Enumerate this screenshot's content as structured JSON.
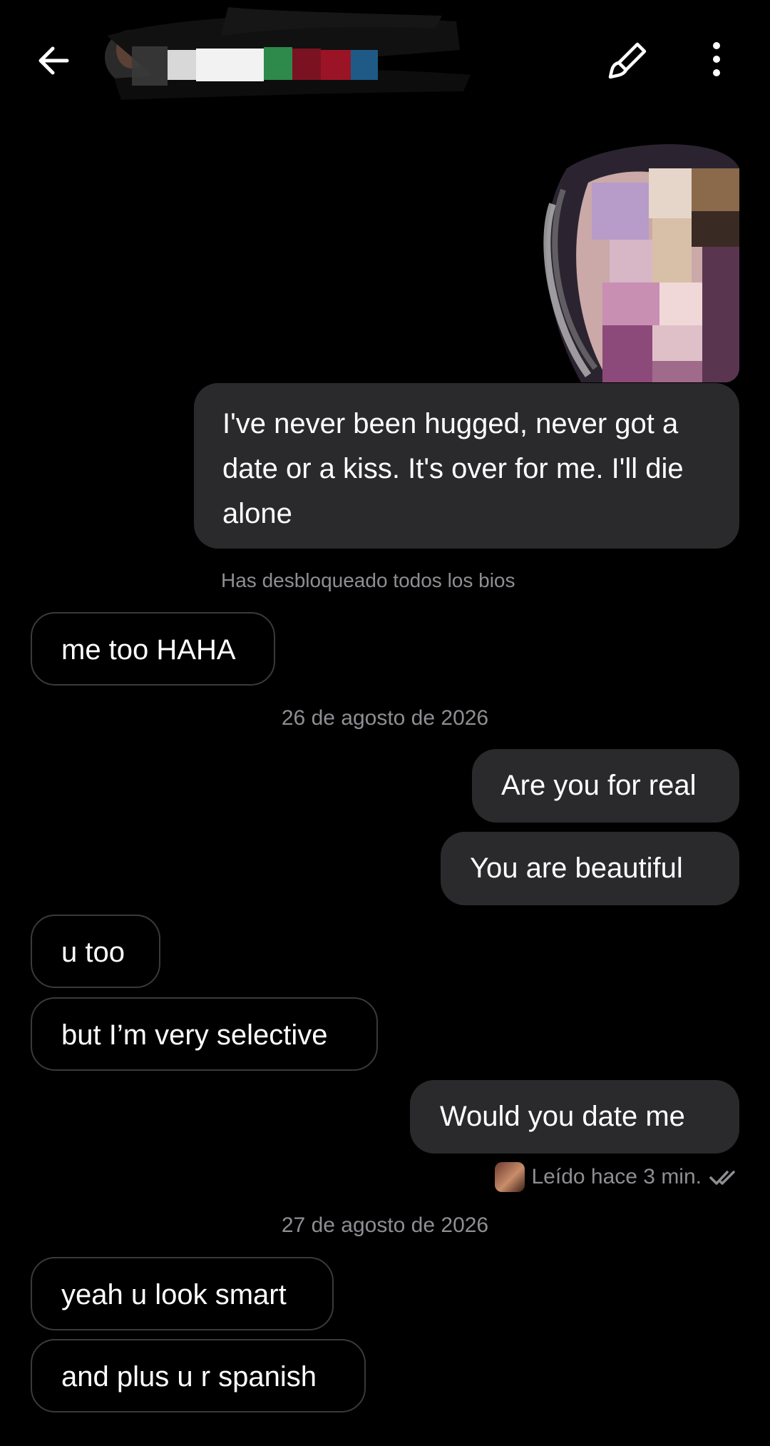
{
  "header": {
    "back_icon": "arrow-left-icon",
    "edit_icon": "paintbrush-icon",
    "more_icon": "more-vertical-icon"
  },
  "messages": [
    {
      "side": "out",
      "type": "image"
    },
    {
      "side": "out",
      "text": "I've never been hugged, never got a date or a kiss. It's over for me. I'll die alone"
    },
    {
      "side": "system",
      "text": "Has desbloqueado todos los bios"
    },
    {
      "side": "in",
      "text": "me too HAHA"
    },
    {
      "side": "date",
      "text": "26 de agosto de 2026"
    },
    {
      "side": "out",
      "text": "Are you for real"
    },
    {
      "side": "out",
      "text": "You are beautiful"
    },
    {
      "side": "in",
      "text": "u too"
    },
    {
      "side": "in",
      "text": "but I’m very selective"
    },
    {
      "side": "out",
      "text": "Would you date me"
    },
    {
      "side": "date",
      "text": "27 de agosto de 2026"
    },
    {
      "side": "in",
      "text": "yeah u look smart"
    },
    {
      "side": "in",
      "text": "and plus u r spanish"
    }
  ],
  "read_receipt": {
    "text": "Leído hace 3 min.",
    "icon": "double-check-icon"
  },
  "colors": {
    "background": "#000000",
    "outgoing_bubble": "#2a2a2c",
    "incoming_border": "#3a3a3c",
    "muted_text": "#8e8e93"
  }
}
